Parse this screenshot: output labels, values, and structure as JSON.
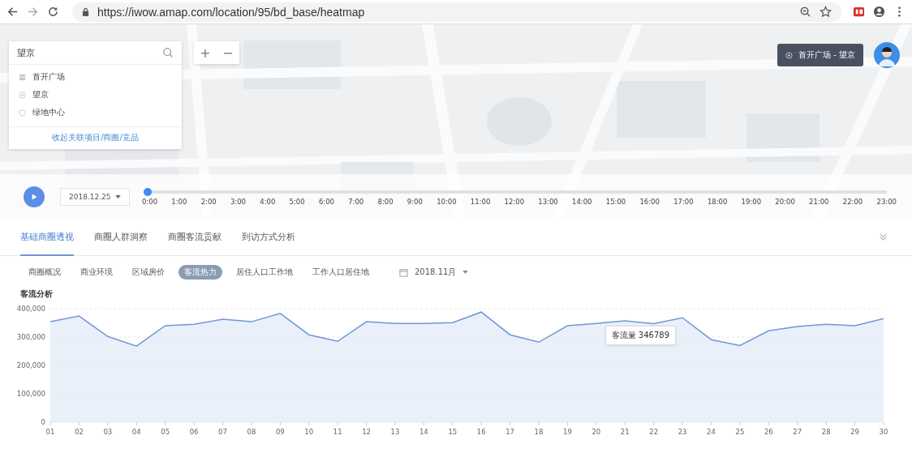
{
  "browser": {
    "url": "https://iwow.amap.com/location/95/bd_base/heatmap"
  },
  "map": {
    "kind": "picture",
    "search": {
      "value": "望京",
      "suggestions": [
        {
          "kind": "store",
          "label": "首开广场"
        },
        {
          "kind": "target",
          "label": "望京"
        },
        {
          "kind": "shield",
          "label": "绿地中心"
        }
      ],
      "collapse_link": "收起关联项目/商圈/竞品"
    },
    "zoom_buttons": [
      "+",
      "−"
    ],
    "location_badge": "首开广场 - 望京"
  },
  "timeline": {
    "date": "2018.12.25",
    "level": 0,
    "hours": [
      "0:00",
      "1:00",
      "2:00",
      "3:00",
      "4:00",
      "5:00",
      "6:00",
      "7:00",
      "8:00",
      "9:00",
      "10:00",
      "11:00",
      "12:00",
      "13:00",
      "14:00",
      "15:00",
      "16:00",
      "17:00",
      "18:00",
      "19:00",
      "20:00",
      "21:00",
      "22:00",
      "23:00"
    ]
  },
  "tabs": [
    {
      "label": "基础商圈透视",
      "selected": true
    },
    {
      "label": "商圈人群洞察",
      "selected": false
    },
    {
      "label": "商圈客流贡献",
      "selected": false
    },
    {
      "label": "到访方式分析",
      "selected": false
    }
  ],
  "subtabs": [
    {
      "label": "商圈概况",
      "selected": false
    },
    {
      "label": "商业环境",
      "selected": false
    },
    {
      "label": "区域房价",
      "selected": false
    },
    {
      "label": "客流热力",
      "selected": true
    },
    {
      "label": "居住人口工作地",
      "selected": false
    },
    {
      "label": "工作人口居住地",
      "selected": false
    }
  ],
  "month": "2018.11月",
  "chart": {
    "title": "客流分析",
    "tooltip": {
      "value": "346789"
    },
    "chart_data": {
      "type": "line",
      "grid": true,
      "categories": [
        "01",
        "02",
        "03",
        "04",
        "05",
        "06",
        "07",
        "08",
        "09",
        "10",
        "11",
        "12",
        "13",
        "14",
        "15",
        "16",
        "17",
        "18",
        "19",
        "20",
        "21",
        "22",
        "23",
        "24",
        "25",
        "26",
        "27",
        "28",
        "29",
        "30"
      ],
      "series": [
        {
          "name": "客流量",
          "color": "#6f97d8",
          "values": [
            354000,
            374000,
            302000,
            268000,
            340000,
            345000,
            363000,
            354000,
            383000,
            308000,
            285000,
            354000,
            348000,
            348000,
            351000,
            388000,
            308000,
            282000,
            340000,
            348000,
            357000,
            347000,
            368000,
            291000,
            270000,
            322000,
            337000,
            345000,
            340000,
            365000
          ]
        }
      ],
      "ylim": [
        0,
        400000
      ],
      "yticks": [
        {
          "value": 0,
          "label": "0"
        },
        {
          "value": 100000,
          "label": "100,000"
        },
        {
          "value": 200000,
          "label": "200,000"
        },
        {
          "value": 300000,
          "label": "300,000"
        },
        {
          "value": 400000,
          "label": "400,000"
        }
      ]
    }
  }
}
